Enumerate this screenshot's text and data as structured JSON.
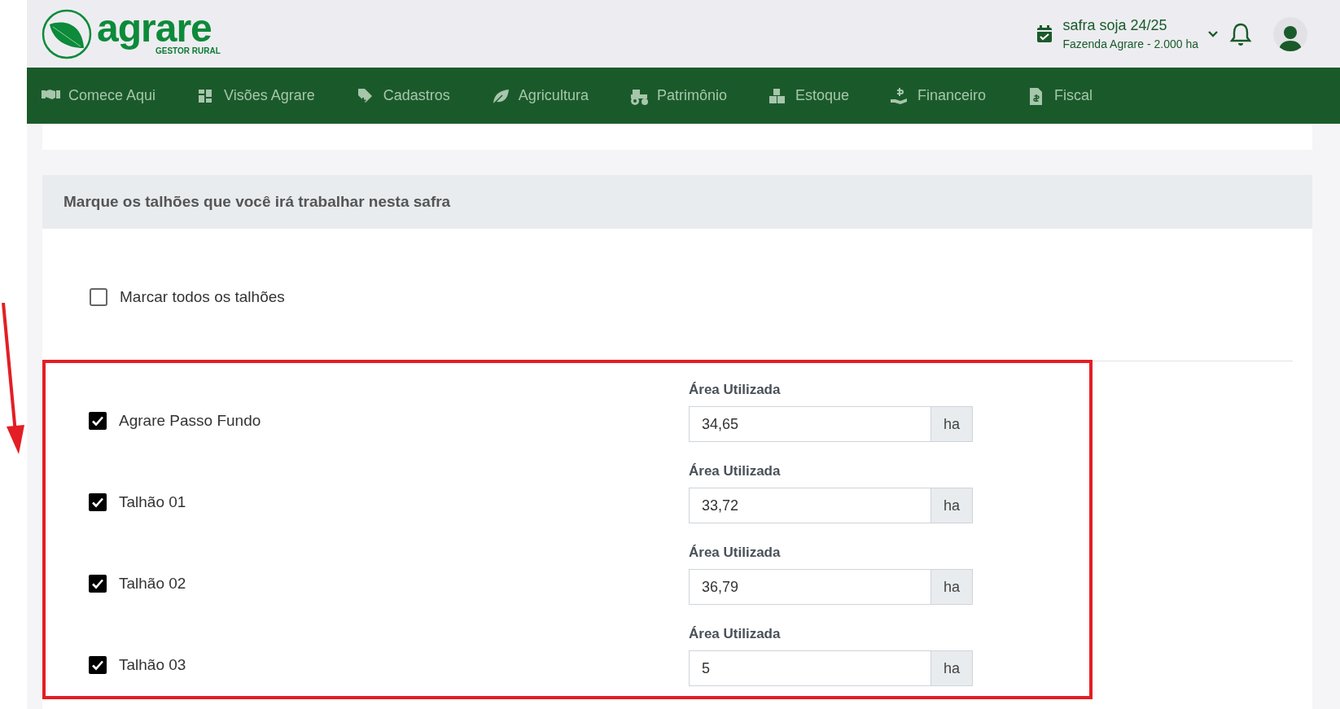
{
  "header": {
    "logo": {
      "name": "agrare",
      "tagline": "GESTOR RURAL"
    },
    "season": {
      "title": "safra soja 24/25",
      "farm": "Fazenda Agrare - 2.000 ha"
    }
  },
  "nav": [
    {
      "label": "Comece Aqui"
    },
    {
      "label": "Visões Agrare"
    },
    {
      "label": "Cadastros"
    },
    {
      "label": "Agricultura"
    },
    {
      "label": "Patrimônio"
    },
    {
      "label": "Estoque"
    },
    {
      "label": "Financeiro"
    },
    {
      "label": "Fiscal"
    }
  ],
  "section": {
    "title": "Marque os talhões que você irá trabalhar nesta safra",
    "select_all": {
      "label": "Marcar todos os talhões",
      "checked": false
    },
    "plots": [
      {
        "name": "Agrare Passo Fundo",
        "checked": true,
        "field_label": "Área Utilizada",
        "value": "34,65",
        "unit": "ha"
      },
      {
        "name": "Talhão 01",
        "checked": true,
        "field_label": "Área Utilizada",
        "value": "33,72",
        "unit": "ha"
      },
      {
        "name": "Talhão 02",
        "checked": true,
        "field_label": "Área Utilizada",
        "value": "36,79",
        "unit": "ha"
      },
      {
        "name": "Talhão 03",
        "checked": true,
        "field_label": "Área Utilizada",
        "value": "5",
        "unit": "ha"
      }
    ]
  }
}
